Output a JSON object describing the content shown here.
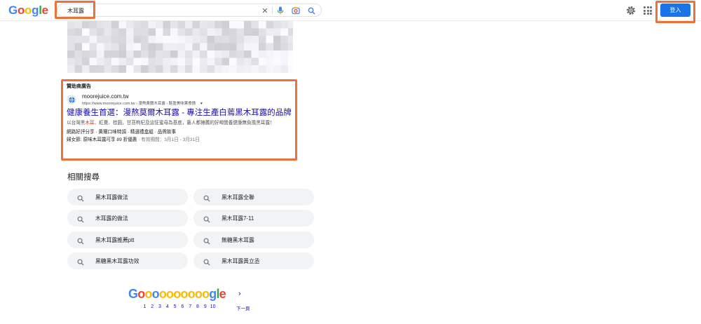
{
  "header": {
    "logo_letters": [
      {
        "ch": "G",
        "color": "#4285f4"
      },
      {
        "ch": "o",
        "color": "#ea4335"
      },
      {
        "ch": "o",
        "color": "#fbbc05"
      },
      {
        "ch": "g",
        "color": "#4285f4"
      },
      {
        "ch": "l",
        "color": "#34a853"
      },
      {
        "ch": "e",
        "color": "#ea4335"
      }
    ],
    "search_query": "木耳露",
    "clear_icon": "✕",
    "signin_label": "登入",
    "highlight_color": "#e8743b",
    "accent_color": "#1a73e8"
  },
  "ad": {
    "label": "贊助商廣告",
    "domain": "moorejuice.com.tw",
    "url_path": "https://www.moorejuice.com.tw › 漫熬黃爾木耳露 › 鞋盈美味果食擔",
    "title": "健康養生首選：漫熬莫爾木耳露 - 專注生產白蔫黑木耳露的品牌",
    "desc_pre": "以台灣黑",
    "desc_highlight": "木耳",
    "desc_post": "、紅棗、桂圓，甘苔枸杞及這怔蜜母為基底，藝人都擁薦的好喝營養健康無負擔黑耳露！",
    "sitelinks": "網路好評分享 · 黃爾口味特調 · 精選禮盒組 · 品牌故事",
    "promo_prefix": "婦女節: 原味木耳露可享 89 折優惠",
    "promo_suffix": " · 有效期間：3月1日 - 3月31日"
  },
  "related": {
    "title": "相關搜尋",
    "items": [
      "黑木耳露做法",
      "黑木耳露全聯",
      "木耳露的做法",
      "黑木耳露7-11",
      "黑木耳露推薦ptt",
      "無糖黑木耳露",
      "黑糖黑木耳露功效",
      "黑木耳露黃立丞"
    ]
  },
  "pagination": {
    "letters": [
      {
        "ch": "G",
        "color": "#4285f4"
      },
      {
        "ch": "o",
        "color": "#ea4335"
      },
      {
        "ch": "o",
        "color": "#fbbc05"
      },
      {
        "ch": "o",
        "color": "#4285f4"
      },
      {
        "ch": "o",
        "color": "#fbbc05"
      },
      {
        "ch": "o",
        "color": "#fbbc05"
      },
      {
        "ch": "o",
        "color": "#fbbc05"
      },
      {
        "ch": "o",
        "color": "#fbbc05"
      },
      {
        "ch": "o",
        "color": "#fbbc05"
      },
      {
        "ch": "o",
        "color": "#fbbc05"
      },
      {
        "ch": "o",
        "color": "#fbbc05"
      },
      {
        "ch": "g",
        "color": "#4285f4"
      },
      {
        "ch": "l",
        "color": "#34a853"
      },
      {
        "ch": "e",
        "color": "#ea4335"
      }
    ],
    "pages": [
      "1",
      "2",
      "3",
      "4",
      "5",
      "6",
      "7",
      "8",
      "9",
      "10"
    ],
    "current_page": "1",
    "next_arrow": "›",
    "next_label": "下一頁"
  }
}
